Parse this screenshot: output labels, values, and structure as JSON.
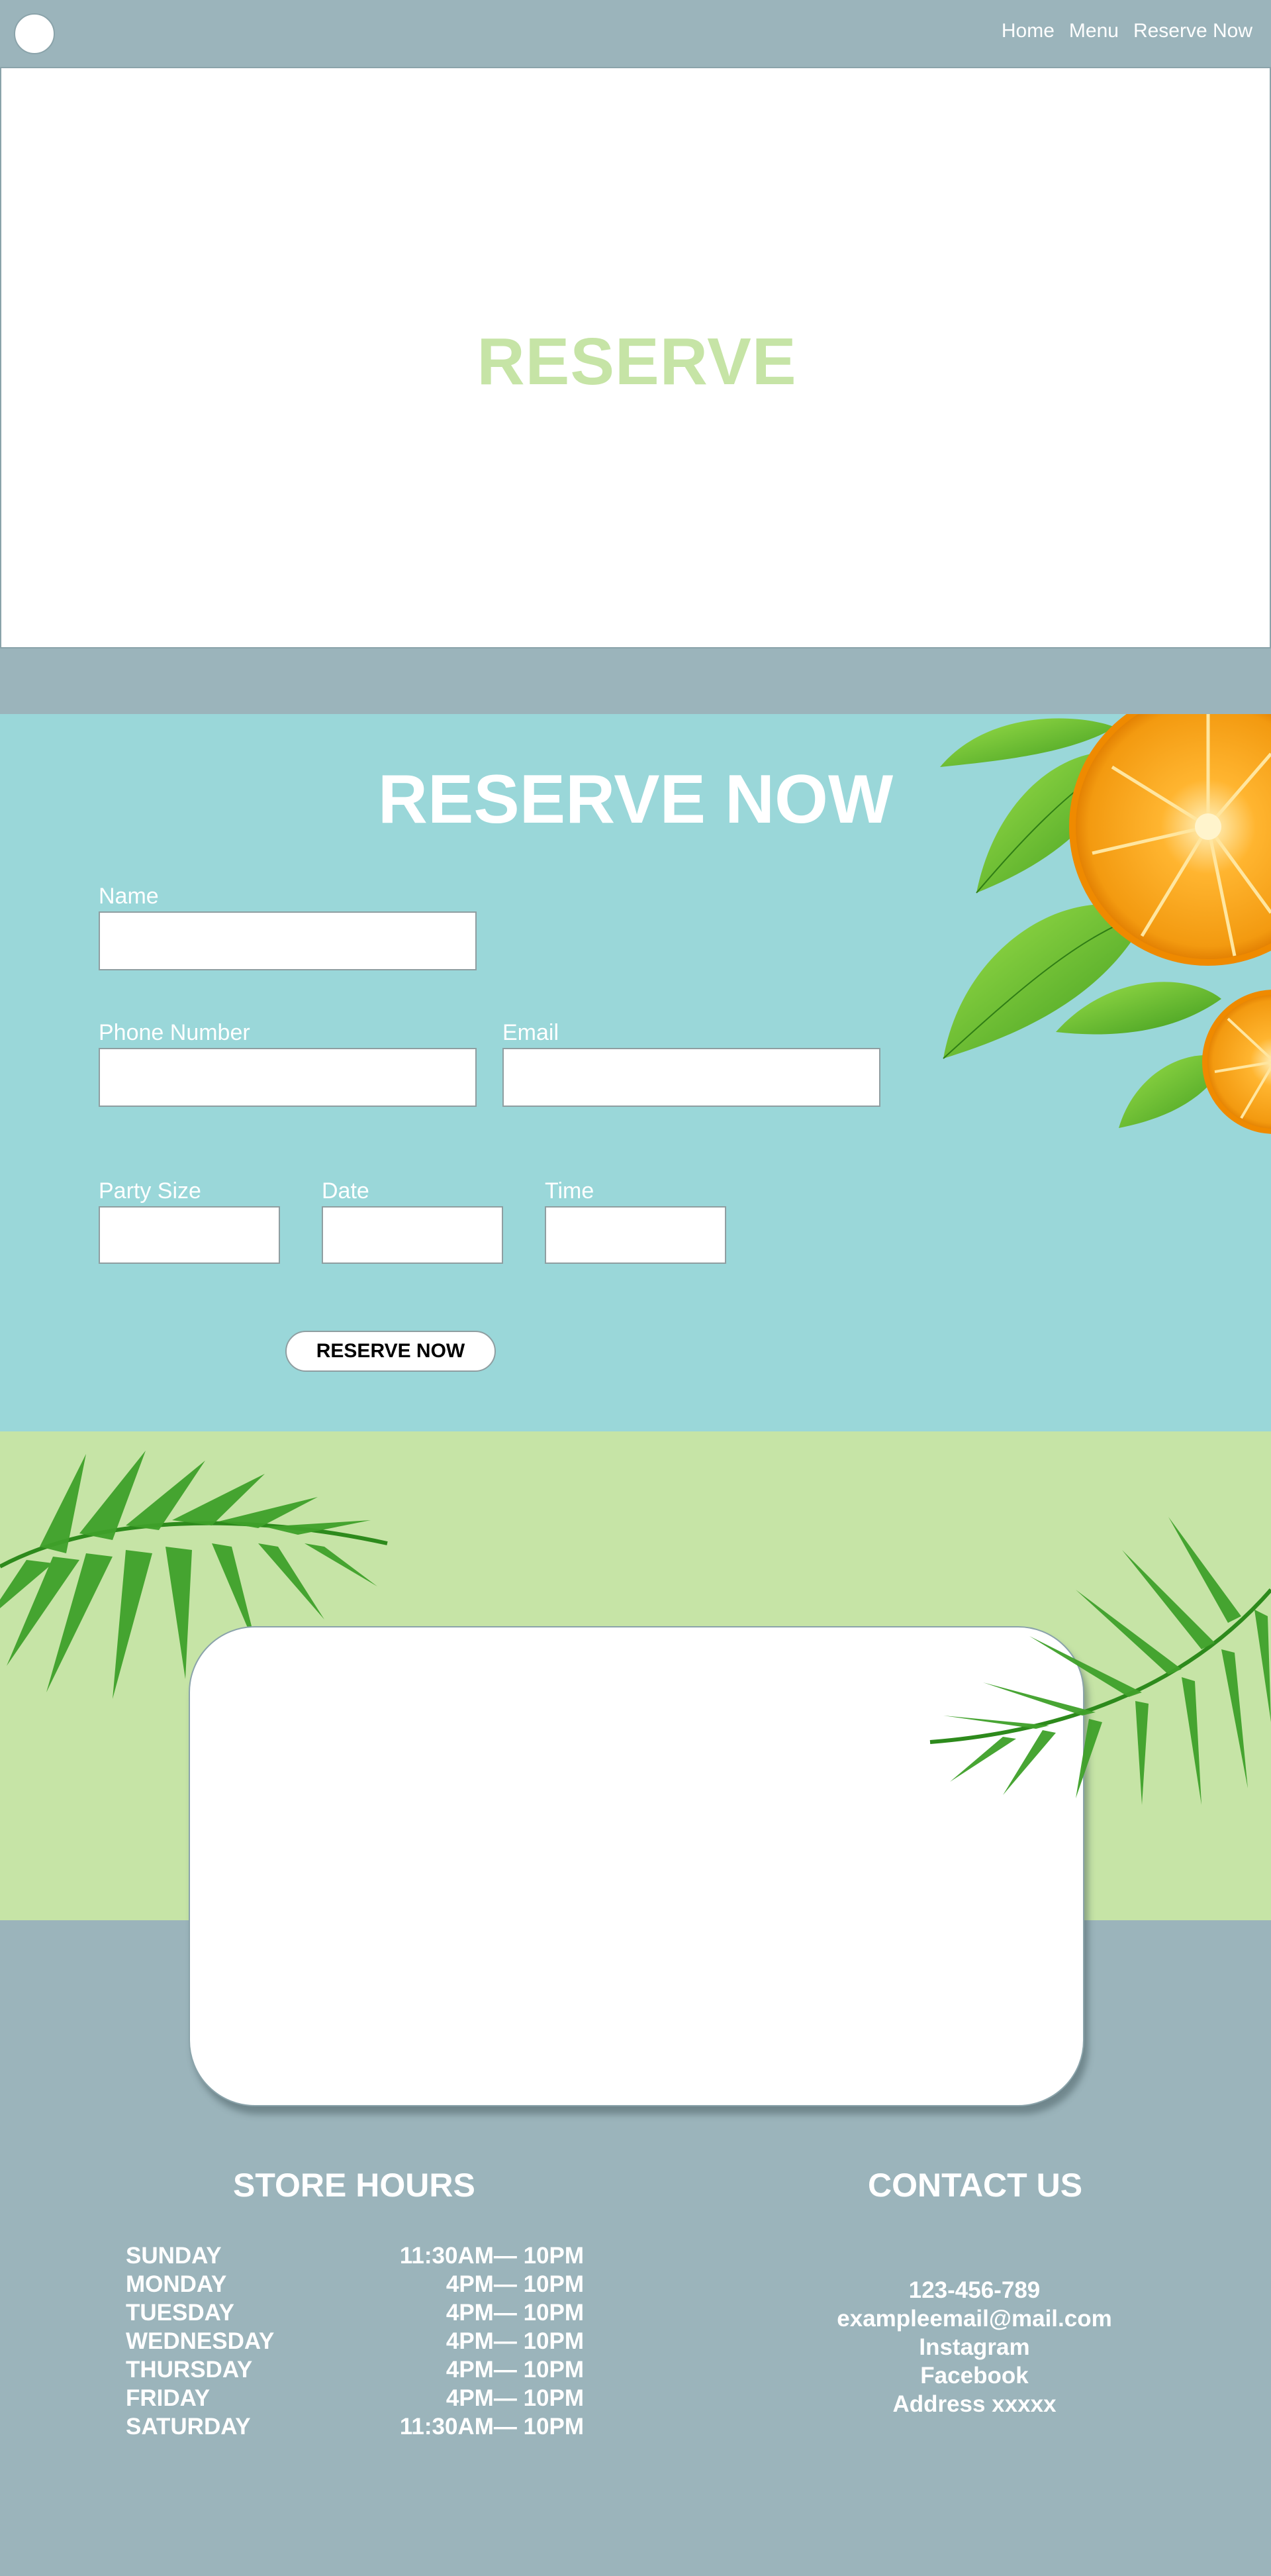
{
  "nav": {
    "links": [
      "Home",
      "Menu",
      "Reserve Now"
    ]
  },
  "hero": {
    "title": "RESERVE"
  },
  "reserve": {
    "title": "RESERVE NOW",
    "fields": {
      "name": {
        "label": "Name",
        "value": ""
      },
      "phone": {
        "label": "Phone Number",
        "value": ""
      },
      "email": {
        "label": "Email",
        "value": ""
      },
      "party_size": {
        "label": "Party Size",
        "value": ""
      },
      "date": {
        "label": "Date",
        "value": ""
      },
      "time": {
        "label": "Time",
        "value": ""
      }
    },
    "submit_label": "RESERVE NOW"
  },
  "store_hours": {
    "title": "STORE HOURS",
    "rows": [
      {
        "day": "SUNDAY",
        "time": "11:30AM— 10PM"
      },
      {
        "day": "MONDAY",
        "time": "4PM— 10PM"
      },
      {
        "day": "TUESDAY",
        "time": "4PM— 10PM"
      },
      {
        "day": "WEDNESDAY",
        "time": "4PM— 10PM"
      },
      {
        "day": "THURSDAY",
        "time": "4PM— 10PM"
      },
      {
        "day": "FRIDAY",
        "time": "4PM— 10PM"
      },
      {
        "day": "SATURDAY",
        "time": "11:30AM— 10PM"
      }
    ]
  },
  "contact": {
    "title": "CONTACT US",
    "lines": [
      "123-456-789",
      "exampleemail@mail.com",
      "Instagram",
      "Facebook",
      "Address xxxxx"
    ]
  },
  "colors": {
    "nav_bg": "#9bb4bb",
    "reserve_bg": "#9ad7d9",
    "band_bg": "#c6e4a6",
    "hero_title": "#c6e4a6"
  }
}
